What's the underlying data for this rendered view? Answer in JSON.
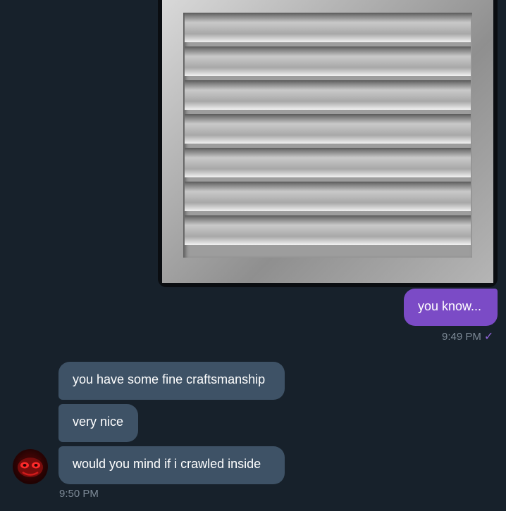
{
  "messages": [
    {
      "from": "me",
      "type": "image",
      "image": "vent-louver-photo"
    },
    {
      "from": "me",
      "type": "text",
      "text": "you know..."
    },
    {
      "from": "them",
      "type": "text",
      "text": "you have some fine craftsmanship"
    },
    {
      "from": "them",
      "type": "text",
      "text": "very nice"
    },
    {
      "from": "them",
      "type": "text",
      "text": "would you mind if i crawled inside"
    }
  ],
  "outgoing_time": "9:49 PM",
  "outgoing_check": "✓",
  "incoming_time": "9:50 PM",
  "colors": {
    "background": "#17212b",
    "outgoing_bubble": "#7b4bc6",
    "incoming_bubble": "#3e5266",
    "timestamp": "#7d8a97",
    "check": "#8f64d8"
  },
  "avatar": {
    "icon": "red-mask-avatar-icon"
  }
}
